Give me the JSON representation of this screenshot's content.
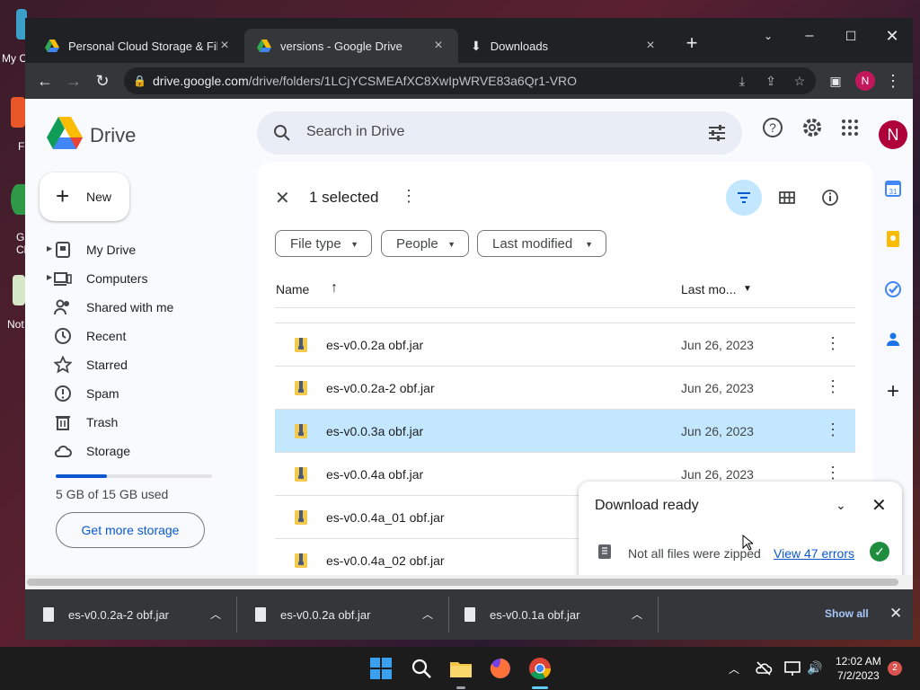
{
  "browser": {
    "tabs": [
      {
        "title": "Personal Cloud Storage & File Sh",
        "active": false
      },
      {
        "title": "versions - Google Drive",
        "active": true
      },
      {
        "title": "Downloads",
        "active": false
      }
    ],
    "url_host": "drive.google.com",
    "url_path": "/drive/folders/1LCjYCSMEAfXC8XwIpWRVE83a6Qr1-VRO",
    "profile_initial": "N"
  },
  "desktop": {
    "icons": [
      {
        "label": "My C"
      },
      {
        "label": "F"
      },
      {
        "label": "G\nCh"
      },
      {
        "label": "Not"
      }
    ]
  },
  "drive": {
    "brand": "Drive",
    "search_placeholder": "Search in Drive",
    "avatar_initial": "N",
    "new_label": "New",
    "nav": [
      {
        "label": "My Drive",
        "icon": "my-drive-icon"
      },
      {
        "label": "Computers",
        "icon": "computers-icon"
      },
      {
        "label": "Shared with me",
        "icon": "shared-icon"
      },
      {
        "label": "Recent",
        "icon": "recent-icon"
      },
      {
        "label": "Starred",
        "icon": "star-icon"
      },
      {
        "label": "Spam",
        "icon": "spam-icon"
      },
      {
        "label": "Trash",
        "icon": "trash-icon"
      },
      {
        "label": "Storage",
        "icon": "cloud-icon"
      }
    ],
    "storage_used_fraction": 0.33,
    "storage_text": "5 GB of 15 GB used",
    "get_more_storage": "Get more storage",
    "selection_text": "1 selected",
    "filters": [
      "File type",
      "People",
      "Last modified"
    ],
    "col_name": "Name",
    "col_modified": "Last mo...",
    "files": [
      {
        "name": "es-v0.0.2a obf.jar",
        "date": "Jun 26, 2023",
        "selected": false
      },
      {
        "name": "es-v0.0.2a-2 obf.jar",
        "date": "Jun 26, 2023",
        "selected": false
      },
      {
        "name": "es-v0.0.3a obf.jar",
        "date": "Jun 26, 2023",
        "selected": true
      },
      {
        "name": "es-v0.0.4a obf.jar",
        "date": "Jun 26, 2023",
        "selected": false
      },
      {
        "name": "es-v0.0.4a_01 obf.jar",
        "date": "",
        "selected": false
      },
      {
        "name": "es-v0.0.4a_02 obf.jar",
        "date": "",
        "selected": false
      }
    ]
  },
  "download_panel": {
    "title": "Download ready",
    "message": "Not all files were zipped",
    "link": "View 47 errors"
  },
  "download_shelf": {
    "items": [
      "es-v0.0.2a-2 obf.jar",
      "es-v0.0.2a obf.jar",
      "es-v0.0.1a obf.jar"
    ],
    "show_all": "Show all"
  },
  "taskbar": {
    "time": "12:02 AM",
    "date": "7/2/2023",
    "notifications": "2"
  },
  "colors": {
    "accent": "#0b57d0",
    "selected_row": "#c2e7ff",
    "chrome_dark": "#202124"
  }
}
